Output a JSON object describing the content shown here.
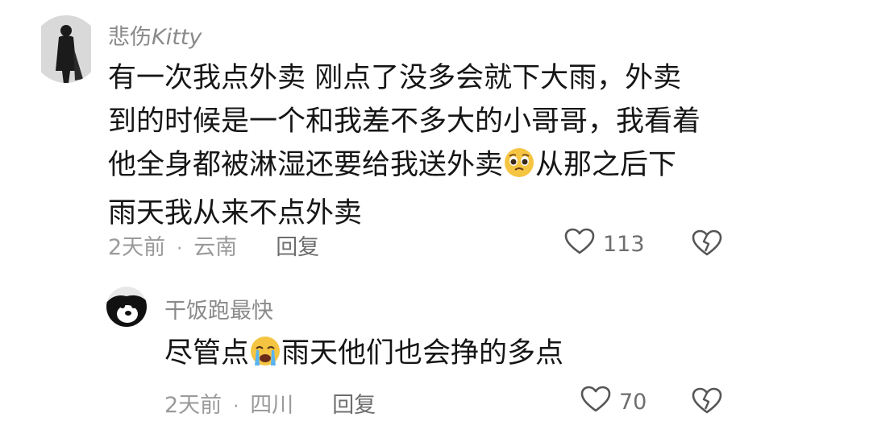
{
  "comments": [
    {
      "username_prefix": "悲伤",
      "username_suffix": "Kitty",
      "lines": [
        "有一次我点外卖 刚点了没多会就下大雨，外卖",
        "到的时候是一个和我差不多大的小哥哥，我看着",
        "他全身都被淋湿还要给我送外卖",
        "从那之后下",
        "雨天我从来不点外卖"
      ],
      "emoji": "pleading-face-icon",
      "time": "2天前",
      "location": "云南",
      "reply_label": "回复",
      "likes": "113"
    },
    {
      "username": "干饭跑最快",
      "text_before": "尽管点",
      "emoji": "crying-face-icon",
      "text_after": "雨天他们也会挣的多点",
      "time": "2天前",
      "location": "四川",
      "reply_label": "回复",
      "likes": "70"
    }
  ],
  "colors": {
    "username": "#8a8a8a",
    "text": "#161616",
    "meta": "#9a9a9a",
    "emoji_yellow": "#f5c542"
  }
}
